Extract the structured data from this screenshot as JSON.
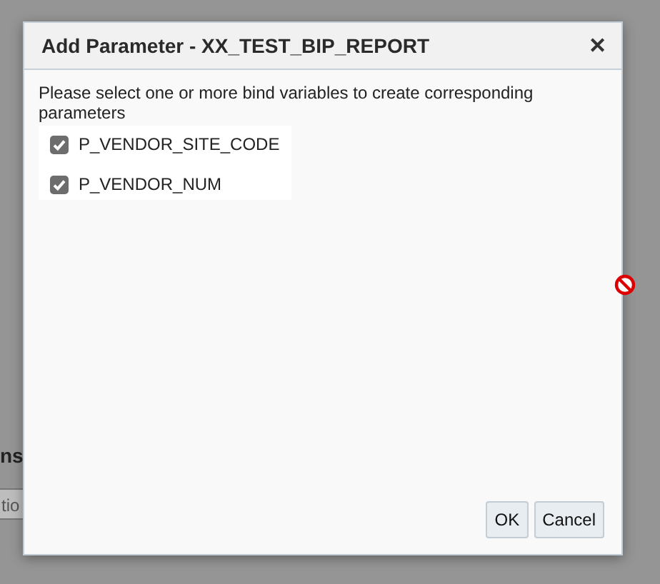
{
  "background": {
    "heading_fragment": "ns",
    "field_fragment": "tio"
  },
  "dialog": {
    "title": "Add Parameter - XX_TEST_BIP_REPORT",
    "close": "✕",
    "instruction": "Please select one or more bind variables to create corresponding parameters",
    "variables": [
      {
        "label": "P_VENDOR_SITE_CODE",
        "checked": true
      },
      {
        "label": "P_VENDOR_NUM",
        "checked": true
      }
    ],
    "buttons": [
      "OK",
      "Cancel"
    ]
  }
}
